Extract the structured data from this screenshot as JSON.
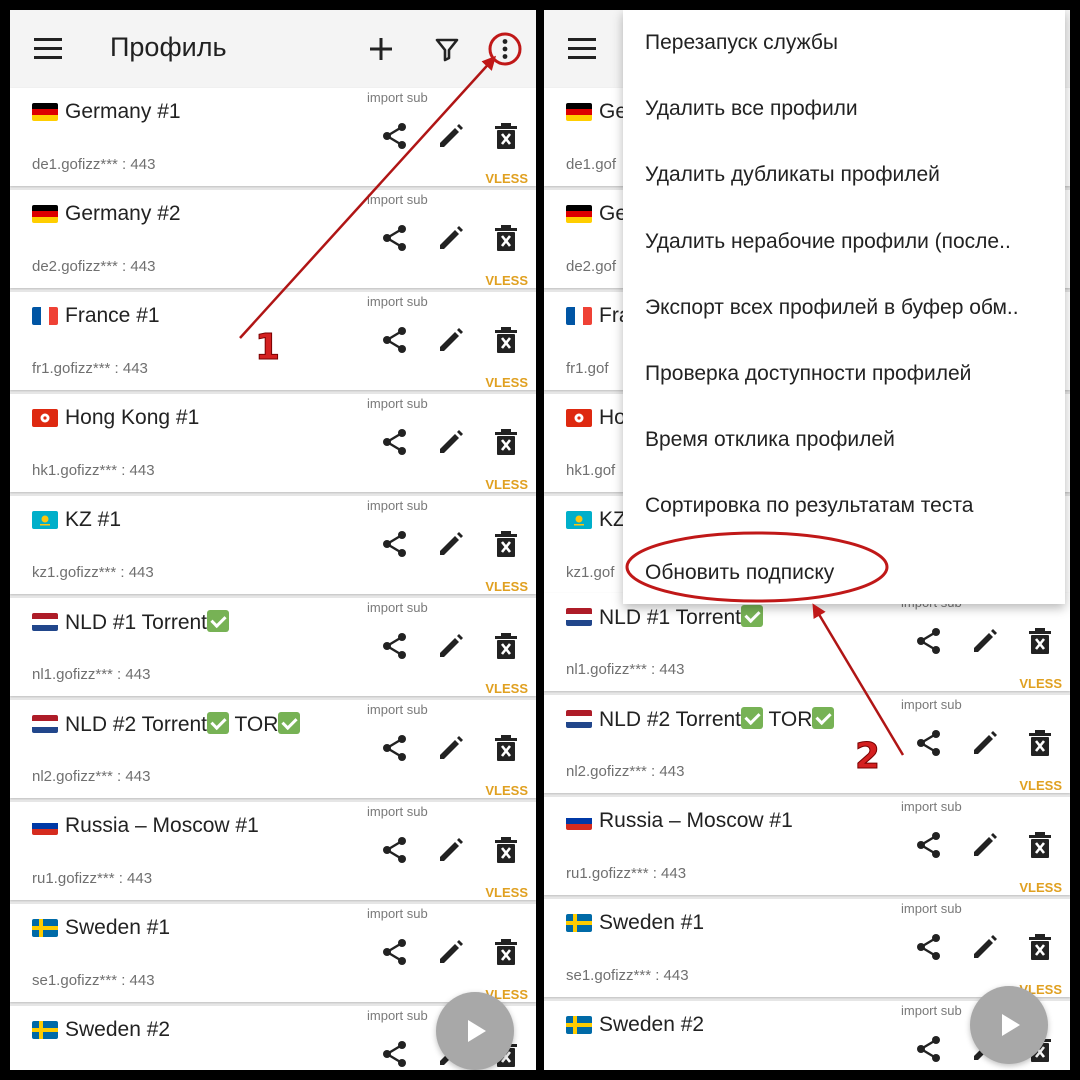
{
  "appbar": {
    "title": "Профиль"
  },
  "profiles": [
    {
      "flag": "de",
      "name": "Germany #1",
      "addr": "de1.gofizz*** : 443",
      "sub": "import sub",
      "proto": "VLESS"
    },
    {
      "flag": "de",
      "name": "Germany #2",
      "addr": "de2.gofizz*** : 443",
      "sub": "import sub",
      "proto": "VLESS"
    },
    {
      "flag": "fr",
      "name": "France #1",
      "addr": "fr1.gofizz*** : 443",
      "sub": "import sub",
      "proto": "VLESS"
    },
    {
      "flag": "hk",
      "name": "Hong Kong #1",
      "addr": "hk1.gofizz*** : 443",
      "sub": "import sub",
      "proto": "VLESS"
    },
    {
      "flag": "kz",
      "name": "KZ #1",
      "addr": "kz1.gofizz*** : 443",
      "sub": "import sub",
      "proto": "VLESS"
    },
    {
      "flag": "nl",
      "name": "NLD #1 Torrent",
      "addr": "nl1.gofizz*** : 443",
      "sub": "import sub",
      "proto": "VLESS"
    },
    {
      "flag": "nl",
      "name": "NLD #2 Torrent",
      "name2": " TOR",
      "addr": "nl2.gofizz*** : 443",
      "sub": "import sub",
      "proto": "VLESS"
    },
    {
      "flag": "ru",
      "name": "Russia – Moscow #1",
      "addr": "ru1.gofizz*** : 443",
      "sub": "import sub",
      "proto": "VLESS"
    },
    {
      "flag": "se",
      "name": "Sweden #1",
      "addr": "se1.gofizz*** : 443",
      "sub": "import sub",
      "proto": "VLESS"
    },
    {
      "flag": "se",
      "name": "Sweden #2",
      "addr": "",
      "sub": "import sub",
      "proto": ""
    }
  ],
  "right_partial_names": [
    "Ge",
    "Ge",
    "Fra",
    "Ho",
    "KZ"
  ],
  "right_partial_addrs": [
    "de1.gof",
    "de2.gof",
    "fr1.gof",
    "hk1.gof",
    "kz1.gof"
  ],
  "menu": {
    "items": [
      "Перезапуск службы",
      "Удалить все профили",
      "Удалить дубликаты профилей",
      "Удалить нерабочие профили (после..",
      "Экспорт всех профилей в буфер обм..",
      "Проверка доступности профилей",
      "Время отклика профилей",
      "Сортировка по результатам теста",
      "Обновить подписку"
    ]
  },
  "annotations": {
    "step1": "1",
    "step2": "2"
  },
  "colors": {
    "accent_protocol": "#e0a020",
    "annotation": "#c01818",
    "fab": "#a8a8a8"
  },
  "icons": [
    "menu-icon",
    "plus-icon",
    "filter-icon",
    "more-vert-icon",
    "share-icon",
    "edit-icon",
    "delete-icon",
    "play-icon",
    "checkmark-icon"
  ]
}
